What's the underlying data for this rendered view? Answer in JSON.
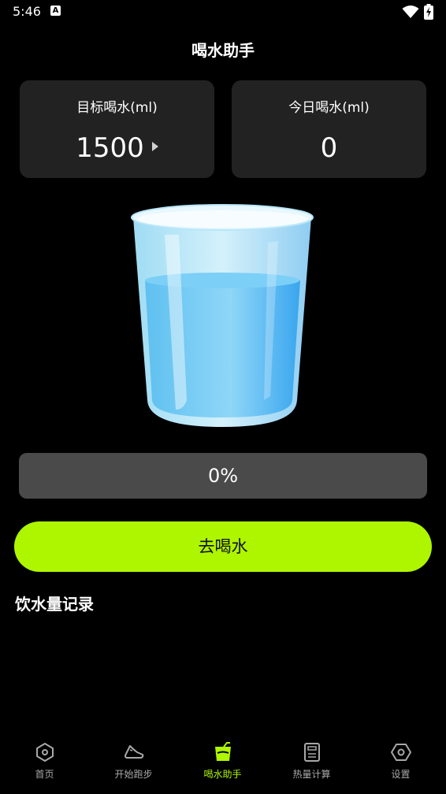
{
  "status_bar": {
    "time": "5:46",
    "notification_icon": "a-icon",
    "wifi_icon": "wifi-icon",
    "battery_icon": "battery-charging-icon"
  },
  "header": {
    "title": "喝水助手"
  },
  "cards": {
    "target": {
      "label": "目标喝水(ml)",
      "value": "1500"
    },
    "today": {
      "label": "今日喝水(ml)",
      "value": "0"
    }
  },
  "glass": {
    "icon": "water-glass-icon"
  },
  "progress": {
    "label": "0%",
    "fraction": 0
  },
  "drink_button": {
    "label": "去喝水"
  },
  "records": {
    "title": "饮水量记录"
  },
  "bottom_nav": {
    "items": [
      {
        "label": "首页",
        "icon": "home-icon"
      },
      {
        "label": "开始跑步",
        "icon": "shoe-icon"
      },
      {
        "label": "喝水助手",
        "icon": "cup-icon"
      },
      {
        "label": "热量计算",
        "icon": "calculator-icon"
      },
      {
        "label": "设置",
        "icon": "settings-icon"
      }
    ],
    "active_index": 2
  },
  "colors": {
    "accent": "#aef500",
    "background": "#000000",
    "card": "#222222",
    "progress_track": "#4a4a4a"
  }
}
